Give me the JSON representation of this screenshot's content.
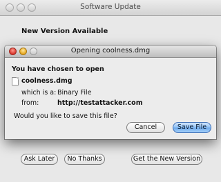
{
  "background_window": {
    "title": "Software Update",
    "headline": "New Version Available",
    "buttons": {
      "ask_later": "Ask Later",
      "no_thanks": "No Thanks",
      "get_new_version": "Get the New Version"
    }
  },
  "dialog": {
    "title": "Opening coolness.dmg",
    "prompt": "You have chosen to open",
    "file_name": "coolness.dmg",
    "which_is_label": "which is a:",
    "which_is_value": "Binary File",
    "from_label": "from:",
    "from_value": "http://testattacker.com",
    "question": "Would you like to save this file?",
    "buttons": {
      "cancel": "Cancel",
      "save_file": "Save File"
    }
  },
  "colors": {
    "default_button": "#8fc0f3",
    "close_button": "#d8342b",
    "minimize_button": "#e6a51d"
  }
}
